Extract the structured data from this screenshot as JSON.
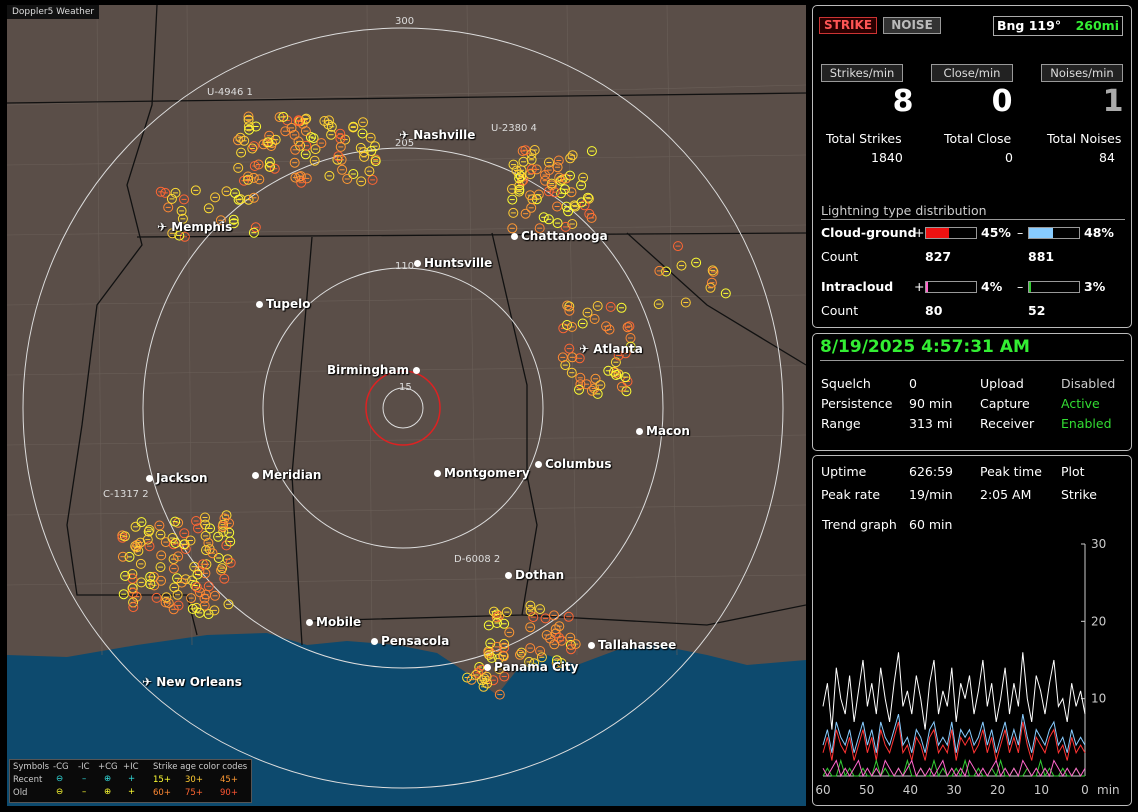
{
  "map": {
    "title": "Doppler5 Weather",
    "range_labels": [
      "300",
      "205",
      "110",
      "15"
    ],
    "storm_cells": [
      "U-4946 1",
      "U-2380 4",
      "C-1317 2",
      "D-6008 2"
    ],
    "cities": [
      {
        "name": "Nashville",
        "icon": "airport-icon"
      },
      {
        "name": "Memphis",
        "icon": "airport-icon"
      },
      {
        "name": "Chattanooga",
        "icon": "city-dot"
      },
      {
        "name": "Huntsville",
        "icon": "city-dot"
      },
      {
        "name": "Tupelo",
        "icon": "city-dot"
      },
      {
        "name": "Atlanta",
        "icon": "airport-icon"
      },
      {
        "name": "Birmingham",
        "icon": "city-dot"
      },
      {
        "name": "Macon",
        "icon": "city-dot"
      },
      {
        "name": "Jackson",
        "icon": "city-dot"
      },
      {
        "name": "Meridian",
        "icon": "city-dot"
      },
      {
        "name": "Montgomery",
        "icon": "city-dot"
      },
      {
        "name": "Columbus",
        "icon": "city-dot"
      },
      {
        "name": "Dothan",
        "icon": "city-dot"
      },
      {
        "name": "Mobile",
        "icon": "city-dot"
      },
      {
        "name": "Pensacola",
        "icon": "city-dot"
      },
      {
        "name": "Tallahassee",
        "icon": "city-dot"
      },
      {
        "name": "Panama City",
        "icon": "city-dot"
      },
      {
        "name": "New Orleans",
        "icon": "airport-icon"
      }
    ],
    "legend": {
      "symbols": "Symbols",
      "cols": [
        "-CG",
        "-IC",
        "+CG",
        "+IC"
      ],
      "recent": "Recent",
      "old": "Old",
      "age_title": "Strike age color codes",
      "ages_recent": [
        "15+",
        "30+",
        "45+"
      ],
      "ages_old": [
        "60+",
        "75+",
        "90+"
      ],
      "colors_recent": [
        "#ffff33",
        "#ffcc33",
        "#ff9933"
      ],
      "colors_old": [
        "#ff8833",
        "#ff6633",
        "#ff5533"
      ]
    }
  },
  "status": {
    "strike_btn": "STRIKE",
    "noise_btn": "NOISE",
    "bearing": "Bng 119°",
    "distance": "260mi",
    "rates": [
      {
        "label": "Strikes/min",
        "value": "8"
      },
      {
        "label": "Close/min",
        "value": "0"
      },
      {
        "label": "Noises/min",
        "value": "1"
      }
    ],
    "totals": [
      {
        "label": "Total Strikes",
        "value": "1840"
      },
      {
        "label": "Total Close",
        "value": "0"
      },
      {
        "label": "Total Noises",
        "value": "84"
      }
    ],
    "dist_title": "Lightning type distribution",
    "cg_label": "Cloud-ground",
    "ic_label": "Intracloud",
    "count_label": "Count",
    "cg_pos_pct": "45%",
    "cg_neg_pct": "48%",
    "cg_pos_count": "827",
    "cg_neg_count": "881",
    "ic_pos_pct": "4%",
    "ic_neg_pct": "3%",
    "ic_pos_count": "80",
    "ic_neg_count": "52",
    "bar_fracs": {
      "cg_pos": 0.45,
      "cg_neg": 0.48,
      "ic_pos": 0.04,
      "ic_neg": 0.03
    },
    "plus": "+",
    "minus": "–"
  },
  "settings": {
    "datetime": "8/19/2025 4:57:31 AM",
    "rows": [
      {
        "k1": "Squelch",
        "v1": "0",
        "k2": "Upload",
        "v2": "Disabled"
      },
      {
        "k1": "Persistence",
        "v1": "90 min",
        "k2": "Capture",
        "v2": "Active"
      },
      {
        "k1": "Range",
        "v1": "313 mi",
        "k2": "Receiver",
        "v2": "Enabled"
      }
    ],
    "v2_colors": [
      "#cccccc",
      "#33dd33",
      "#33dd33"
    ]
  },
  "stats": {
    "uptime_label": "Uptime",
    "uptime": "626:59",
    "peak_time_label": "Peak time",
    "plot_label": "Plot",
    "peak_rate_label": "Peak rate",
    "peak_rate": "19/min",
    "peak_time": "2:05 AM",
    "plot": "Strike",
    "trend_label": "Trend graph",
    "trend": "60 min"
  },
  "chart_data": {
    "type": "line",
    "x_ticks": [
      "60",
      "50",
      "40",
      "30",
      "20",
      "10",
      "0"
    ],
    "x_unit": "min",
    "y_ticks": [
      "30",
      "20",
      "10"
    ],
    "ylim": [
      0,
      30
    ],
    "series": [
      {
        "color": "#ffffff",
        "values": [
          9,
          12,
          6,
          14,
          10,
          8,
          13,
          7,
          11,
          15,
          9,
          12,
          8,
          14,
          10,
          7,
          12,
          16,
          9,
          11,
          8,
          13,
          10,
          6,
          12,
          15,
          8,
          11,
          9,
          14,
          7,
          12,
          10,
          13,
          8,
          11,
          15,
          9,
          12,
          7,
          10,
          14,
          8,
          12,
          9,
          16,
          10,
          7,
          13,
          11,
          8,
          12,
          15,
          9,
          10,
          7,
          12,
          9,
          11,
          8
        ]
      },
      {
        "color": "#ff3333",
        "values": [
          3,
          5,
          2,
          6,
          4,
          3,
          5,
          2,
          4,
          6,
          3,
          5,
          2,
          6,
          4,
          3,
          5,
          7,
          3,
          4,
          2,
          5,
          4,
          2,
          5,
          6,
          3,
          4,
          3,
          6,
          2,
          5,
          4,
          5,
          3,
          4,
          6,
          3,
          5,
          2,
          4,
          6,
          3,
          5,
          3,
          7,
          4,
          2,
          5,
          4,
          3,
          5,
          6,
          3,
          4,
          2,
          5,
          3,
          4,
          3
        ]
      },
      {
        "color": "#88ccff",
        "values": [
          4,
          6,
          3,
          7,
          5,
          4,
          6,
          3,
          5,
          7,
          4,
          6,
          3,
          7,
          5,
          4,
          6,
          8,
          4,
          5,
          3,
          6,
          5,
          3,
          6,
          7,
          4,
          5,
          4,
          7,
          3,
          6,
          5,
          6,
          4,
          5,
          7,
          4,
          6,
          3,
          5,
          7,
          4,
          6,
          4,
          8,
          5,
          3,
          6,
          5,
          4,
          6,
          7,
          4,
          5,
          3,
          6,
          4,
          5,
          4
        ]
      },
      {
        "color": "#33cc33",
        "values": [
          0,
          1,
          0,
          0,
          2,
          0,
          1,
          0,
          0,
          1,
          0,
          0,
          2,
          0,
          1,
          0,
          0,
          1,
          0,
          2,
          0,
          0,
          1,
          0,
          0,
          2,
          0,
          1,
          0,
          0,
          1,
          0,
          2,
          0,
          0,
          1,
          0,
          0,
          1,
          0,
          2,
          0,
          0,
          1,
          0,
          0,
          1,
          0,
          0,
          2,
          0,
          1,
          0,
          0,
          1,
          0,
          0,
          1,
          0,
          0
        ]
      },
      {
        "color": "#ff66cc",
        "values": [
          1,
          0,
          1,
          2,
          0,
          1,
          0,
          1,
          2,
          0,
          1,
          0,
          1,
          0,
          2,
          1,
          0,
          1,
          0,
          1,
          2,
          0,
          1,
          0,
          1,
          0,
          1,
          2,
          0,
          1,
          0,
          1,
          0,
          2,
          1,
          0,
          1,
          0,
          1,
          2,
          0,
          1,
          0,
          1,
          0,
          2,
          1,
          0,
          1,
          0,
          1,
          0,
          2,
          1,
          0,
          1,
          0,
          1,
          0,
          1
        ]
      }
    ]
  }
}
